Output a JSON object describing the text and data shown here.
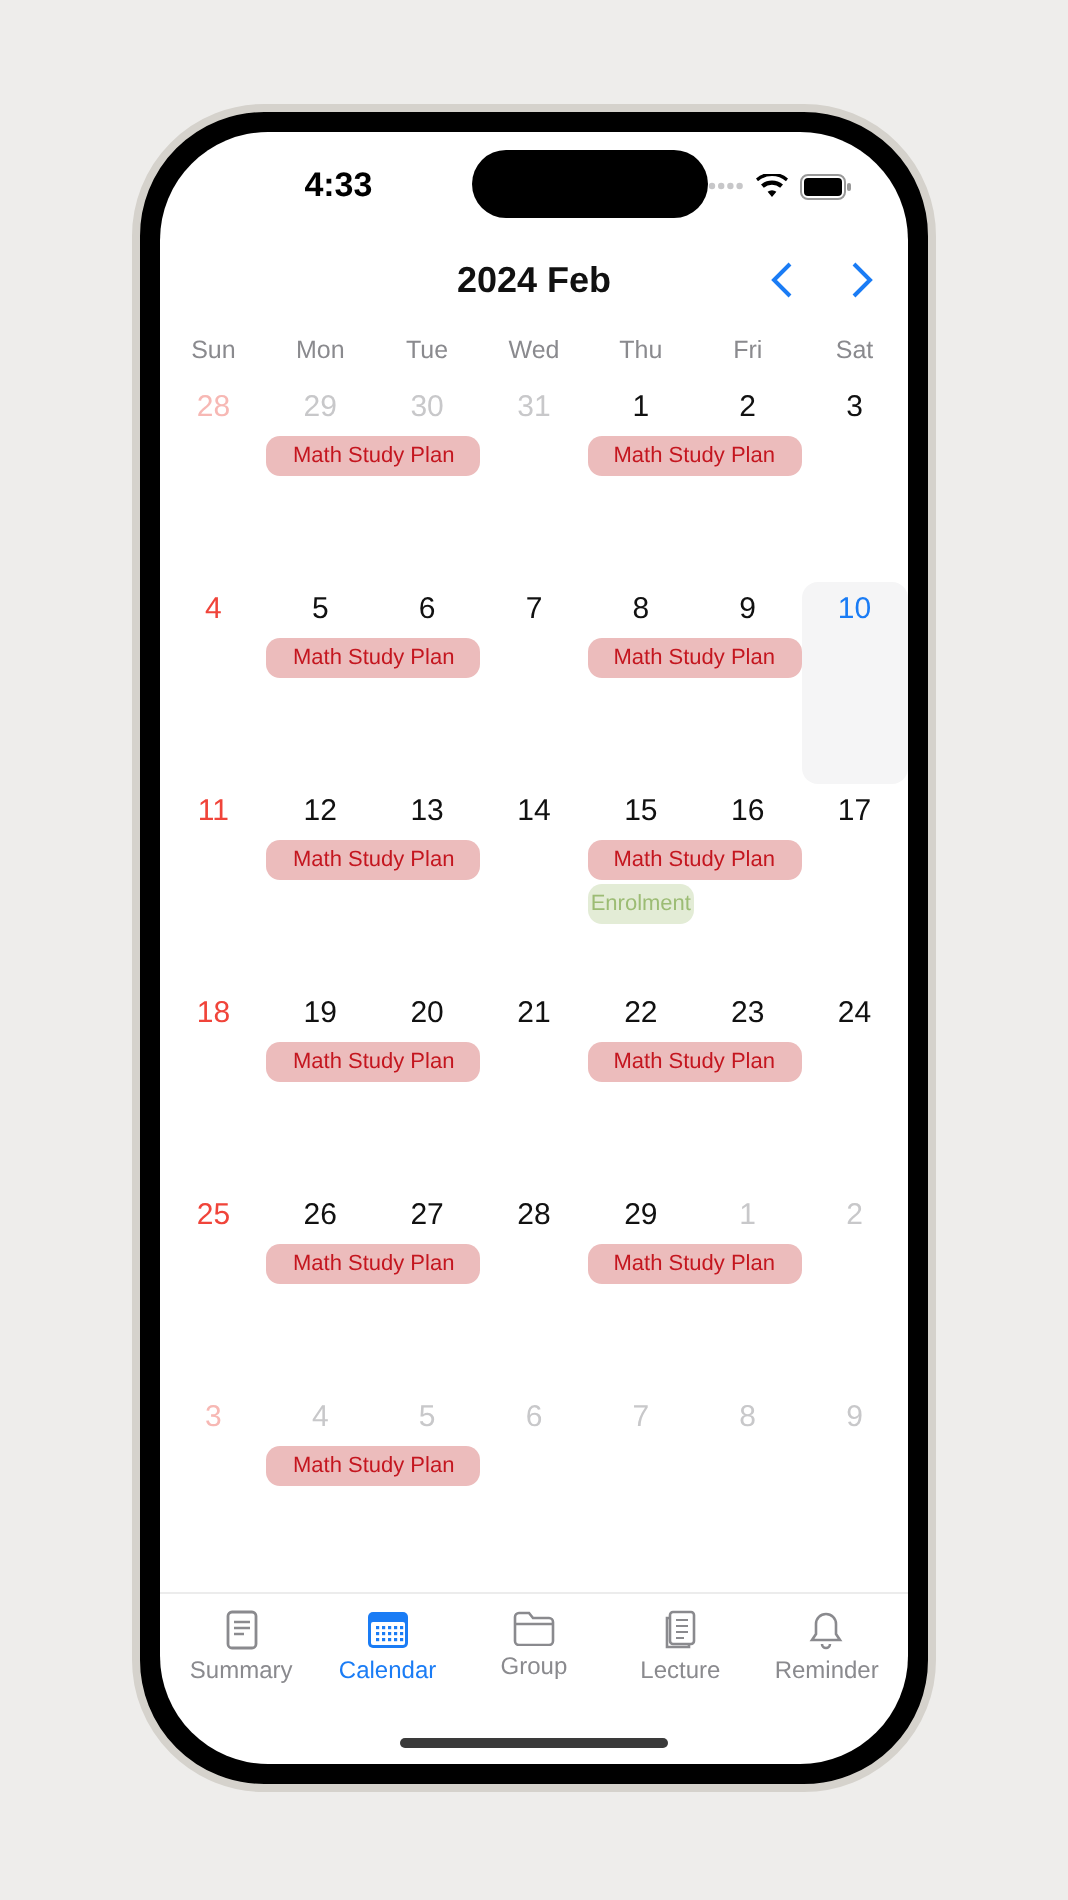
{
  "status_bar": {
    "time": "4:33"
  },
  "header": {
    "title": "2024 Feb"
  },
  "weekdays": [
    "Sun",
    "Mon",
    "Tue",
    "Wed",
    "Thu",
    "Fri",
    "Sat"
  ],
  "weeks": [
    {
      "days": [
        {
          "label": "28",
          "in_month": false,
          "selected": false
        },
        {
          "label": "29",
          "in_month": false,
          "selected": false,
          "events": [
            {
              "label": "Math Study Plan",
              "kind": "plan",
              "spans_next_day": true
            }
          ]
        },
        {
          "label": "30",
          "in_month": false,
          "selected": false
        },
        {
          "label": "31",
          "in_month": false,
          "selected": false
        },
        {
          "label": "1",
          "in_month": true,
          "selected": false,
          "events": [
            {
              "label": "Math Study Plan",
              "kind": "plan",
              "spans_next_day": true
            }
          ]
        },
        {
          "label": "2",
          "in_month": true,
          "selected": false
        },
        {
          "label": "3",
          "in_month": true,
          "selected": false
        }
      ]
    },
    {
      "days": [
        {
          "label": "4",
          "in_month": true,
          "selected": false
        },
        {
          "label": "5",
          "in_month": true,
          "selected": false,
          "events": [
            {
              "label": "Math Study Plan",
              "kind": "plan",
              "spans_next_day": true
            }
          ]
        },
        {
          "label": "6",
          "in_month": true,
          "selected": false
        },
        {
          "label": "7",
          "in_month": true,
          "selected": false
        },
        {
          "label": "8",
          "in_month": true,
          "selected": false,
          "events": [
            {
              "label": "Math Study Plan",
              "kind": "plan",
              "spans_next_day": true
            }
          ]
        },
        {
          "label": "9",
          "in_month": true,
          "selected": false
        },
        {
          "label": "10",
          "in_month": true,
          "selected": true
        }
      ]
    },
    {
      "days": [
        {
          "label": "11",
          "in_month": true,
          "selected": false
        },
        {
          "label": "12",
          "in_month": true,
          "selected": false,
          "events": [
            {
              "label": "Math Study Plan",
              "kind": "plan",
              "spans_next_day": true
            }
          ]
        },
        {
          "label": "13",
          "in_month": true,
          "selected": false
        },
        {
          "label": "14",
          "in_month": true,
          "selected": false
        },
        {
          "label": "15",
          "in_month": true,
          "selected": false,
          "events": [
            {
              "label": "Math Study Plan",
              "kind": "plan",
              "spans_next_day": true
            },
            {
              "label": "Enrolment",
              "kind": "enrolment",
              "spans_next_day": false
            }
          ]
        },
        {
          "label": "16",
          "in_month": true,
          "selected": false
        },
        {
          "label": "17",
          "in_month": true,
          "selected": false
        }
      ]
    },
    {
      "days": [
        {
          "label": "18",
          "in_month": true,
          "selected": false
        },
        {
          "label": "19",
          "in_month": true,
          "selected": false,
          "events": [
            {
              "label": "Math Study Plan",
              "kind": "plan",
              "spans_next_day": true
            }
          ]
        },
        {
          "label": "20",
          "in_month": true,
          "selected": false
        },
        {
          "label": "21",
          "in_month": true,
          "selected": false
        },
        {
          "label": "22",
          "in_month": true,
          "selected": false,
          "events": [
            {
              "label": "Math Study Plan",
              "kind": "plan",
              "spans_next_day": true
            }
          ]
        },
        {
          "label": "23",
          "in_month": true,
          "selected": false
        },
        {
          "label": "24",
          "in_month": true,
          "selected": false
        }
      ]
    },
    {
      "days": [
        {
          "label": "25",
          "in_month": true,
          "selected": false
        },
        {
          "label": "26",
          "in_month": true,
          "selected": false,
          "events": [
            {
              "label": "Math Study Plan",
              "kind": "plan",
              "spans_next_day": true
            }
          ]
        },
        {
          "label": "27",
          "in_month": true,
          "selected": false
        },
        {
          "label": "28",
          "in_month": true,
          "selected": false
        },
        {
          "label": "29",
          "in_month": true,
          "selected": false,
          "events": [
            {
              "label": "Math Study Plan",
              "kind": "plan",
              "spans_next_day": true
            }
          ]
        },
        {
          "label": "1",
          "in_month": false,
          "selected": false
        },
        {
          "label": "2",
          "in_month": false,
          "selected": false
        }
      ]
    },
    {
      "days": [
        {
          "label": "3",
          "in_month": false,
          "selected": false
        },
        {
          "label": "4",
          "in_month": false,
          "selected": false,
          "events": [
            {
              "label": "Math Study Plan",
              "kind": "plan",
              "spans_next_day": true
            }
          ]
        },
        {
          "label": "5",
          "in_month": false,
          "selected": false
        },
        {
          "label": "6",
          "in_month": false,
          "selected": false
        },
        {
          "label": "7",
          "in_month": false,
          "selected": false
        },
        {
          "label": "8",
          "in_month": false,
          "selected": false
        },
        {
          "label": "9",
          "in_month": false,
          "selected": false
        }
      ]
    }
  ],
  "tabs": [
    {
      "label": "Summary",
      "kind": "document",
      "selected": false
    },
    {
      "label": "Calendar",
      "kind": "calendar",
      "selected": true
    },
    {
      "label": "Group",
      "kind": "folder",
      "selected": false
    },
    {
      "label": "Lecture",
      "kind": "pages",
      "selected": false
    },
    {
      "label": "Reminder",
      "kind": "bell",
      "selected": false
    }
  ]
}
